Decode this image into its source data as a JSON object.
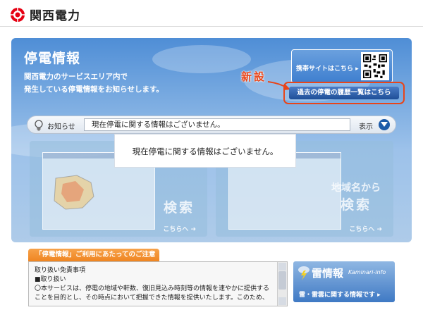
{
  "header": {
    "brand_name": "関西電力"
  },
  "panel": {
    "title": "停電情報",
    "description_line1": "関西電力のサービスエリア内で",
    "description_line2": "発生している停電情報をお知らせします。",
    "mobile_site_label": "携帯サイトはこちら ▸",
    "new_label": "新設",
    "history_button_label": "過去の停電の履歴一覧はこちら"
  },
  "notice_bar": {
    "label": "お知らせ",
    "message": "現在停電に関する情報はございません。",
    "show_label": "表示"
  },
  "cards": {
    "left": {
      "title_line2": "検索",
      "go_label": "こちらへ ➜"
    },
    "right": {
      "title_line1": "地域名から",
      "title_line2": "検索",
      "go_label": "こちらへ ➜"
    }
  },
  "overlay_message": "現在停電に関する情報はございません。",
  "terms": {
    "tab_label": "「停電情報」ご利用にあたってのご注意",
    "heading": "取り扱い免責事項",
    "subheading": "■取り扱い",
    "body": "〇本サービスは、停電の地域や軒数、復旧見込み時刻等の情報を速やかに提供することを目的とし、その時点において把握できた情報を提供いたします。このため、"
  },
  "kaminari": {
    "title": "雷情報",
    "subtitle": "Kaminari-info",
    "description": "雷・雷雲に関する情報です ▸"
  },
  "colors": {
    "accent_red": "#e8451a",
    "brand_blue": "#1e5ca8",
    "notice_orange": "#ef8521"
  }
}
